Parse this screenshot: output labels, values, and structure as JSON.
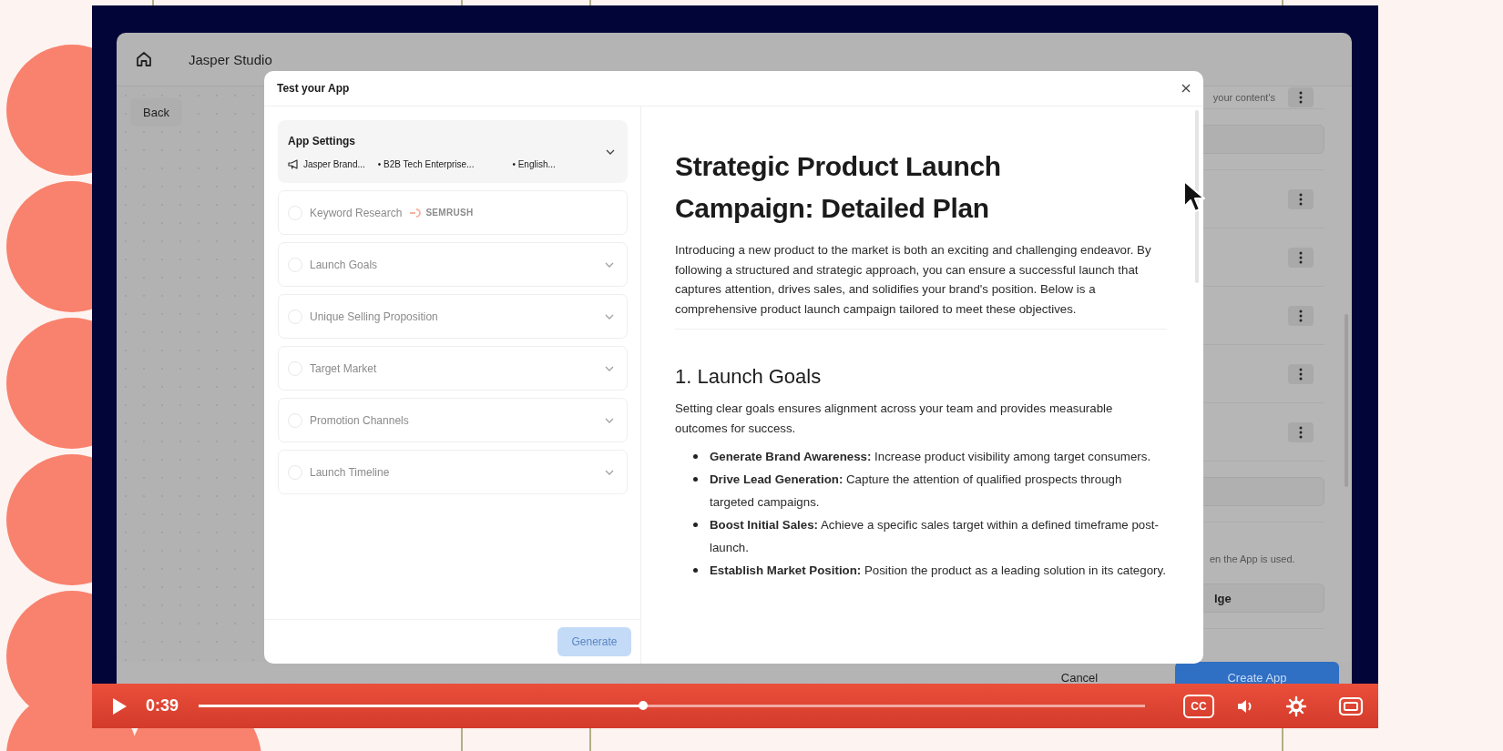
{
  "video": {
    "app": {
      "title": "Jasper Studio",
      "back_button": "Back",
      "panel_rows": [
        {
          "kind": "menu",
          "text": "your content's"
        },
        {
          "kind": "field"
        },
        {
          "kind": "menu"
        },
        {
          "kind": "menu"
        },
        {
          "kind": "menu"
        },
        {
          "kind": "menu"
        },
        {
          "kind": "menu"
        },
        {
          "kind": "field"
        },
        {
          "kind": "note",
          "text": "en the App is used."
        },
        {
          "kind": "field",
          "value": "lge"
        }
      ],
      "buttons": [
        {
          "kind": "secondary",
          "label": "Cancel"
        },
        {
          "kind": "primary",
          "label": "Create App"
        }
      ]
    },
    "modal": {
      "title": "Test your App",
      "app_settings": {
        "title": "App Settings",
        "expanded": false,
        "tags": [
          {
            "kind": "voice",
            "text": "Jasper Brand..."
          },
          {
            "kind": "plain",
            "text": "• B2B Tech Enterprise..."
          },
          {
            "kind": "plain",
            "text": "• English..."
          }
        ]
      },
      "steps": [
        {
          "kind": "integration",
          "label": "Keyword Research",
          "badge": "SEMRUSH",
          "disabled": true
        },
        {
          "kind": "section",
          "label": "Launch Goals",
          "disabled": true
        },
        {
          "kind": "section",
          "label": "Unique Selling Proposition",
          "disabled": true
        },
        {
          "kind": "section",
          "label": "Target Market",
          "disabled": true
        },
        {
          "kind": "section",
          "label": "Promotion Channels",
          "disabled": true
        },
        {
          "kind": "section",
          "label": "Launch Timeline",
          "disabled": true
        }
      ],
      "generate_button": {
        "label": "Generate",
        "disabled": true
      },
      "document": {
        "title": "Strategic Product Launch Campaign: Detailed Plan",
        "intro": "Introducing a new product to the market is both an exciting and challenging endeavor. By following a structured and strategic approach, you can ensure a successful launch that captures attention, drives sales, and solidifies your brand's position. Below is a comprehensive product launch campaign tailored to meet these objectives.",
        "sections": [
          {
            "heading": "1. Launch Goals",
            "text": "Setting clear goals ensures alignment across your team and provides measurable outcomes for success.",
            "bullets": [
              "**Generate Brand Awareness:** Increase product visibility among target consumers.",
              "**Drive Lead Generation:** Capture the attention of qualified prospects through targeted campaigns.",
              "**Boost Initial Sales:** Achieve a specific sales target within a defined timeframe post-launch.",
              "**Establish Market Position:** Position the product as a leading solution in its category."
            ]
          }
        ]
      }
    },
    "player": {
      "playing": false,
      "time": "0:39",
      "level": 0.47,
      "captions_label": "CC"
    }
  }
}
